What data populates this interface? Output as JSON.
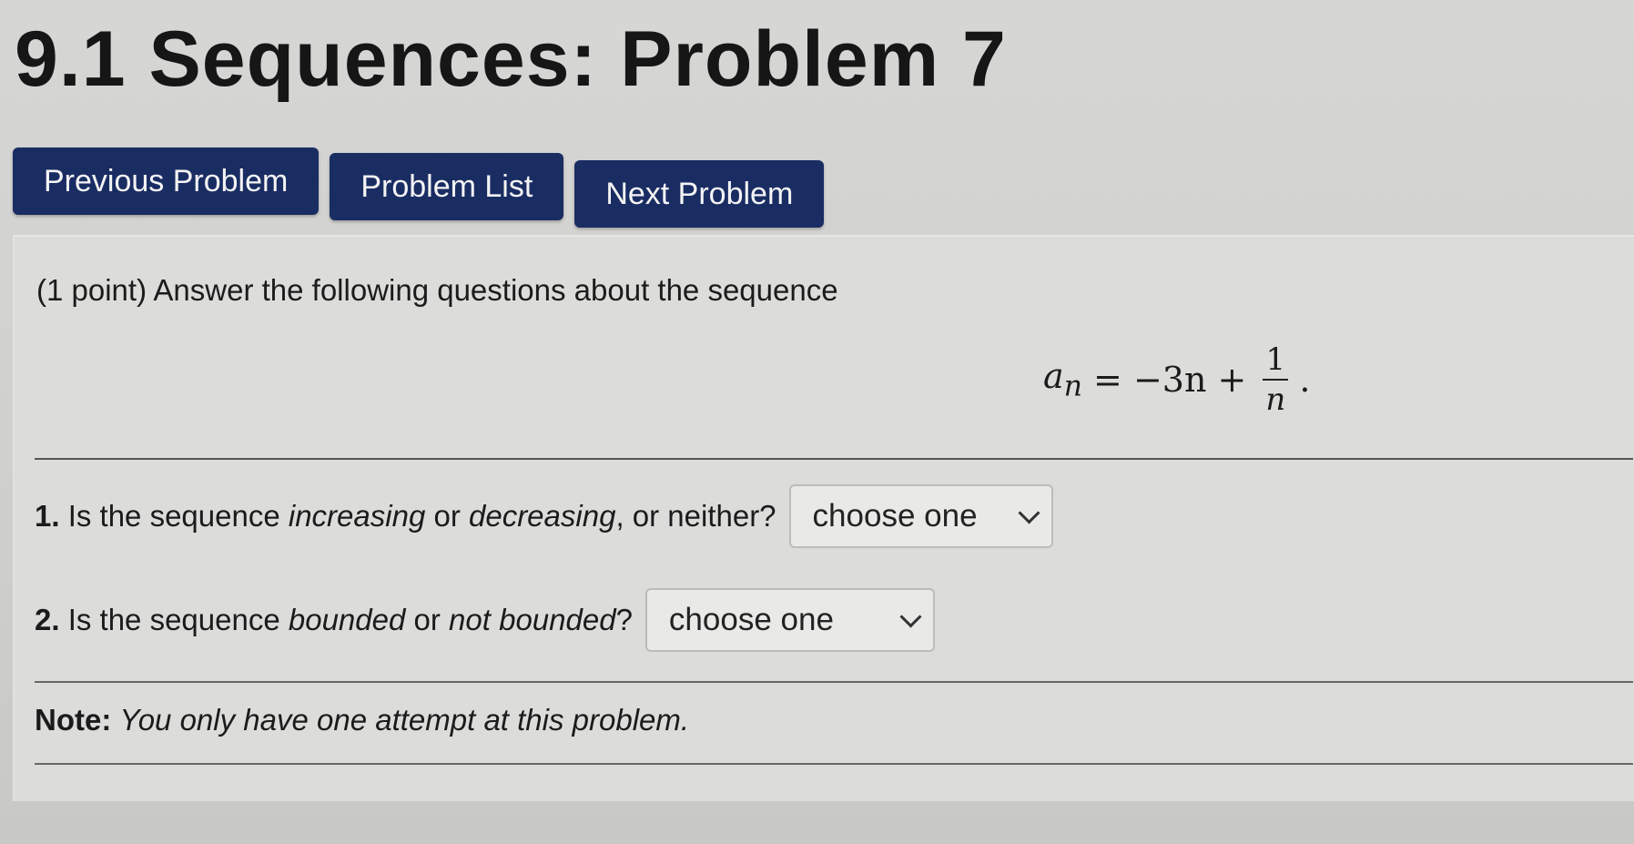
{
  "page_title": "9.1 Sequences: Problem 7",
  "nav": {
    "previous": "Previous Problem",
    "list": "Problem List",
    "next": "Next Problem"
  },
  "problem": {
    "intro": "(1 point) Answer the following questions about the sequence",
    "formula": {
      "lhs": "a",
      "lhs_sub": "n",
      "rhs_prefix": "= −3n +",
      "numerator": "1",
      "denominator": "n",
      "suffix": "."
    },
    "questions": [
      {
        "number": "1.",
        "text_parts": [
          "Is the sequence ",
          "increasing",
          " or ",
          "decreasing",
          ", or neither?"
        ],
        "selected": "choose one"
      },
      {
        "number": "2.",
        "text_parts": [
          "Is the sequence ",
          "bounded",
          " or ",
          "not bounded",
          "?"
        ],
        "selected": "choose one"
      }
    ],
    "note_label": "Note:",
    "note_text": "You only have one attempt at this problem."
  },
  "colors": {
    "button_bg": "#1a2d63",
    "background": "#d6d6d4"
  }
}
